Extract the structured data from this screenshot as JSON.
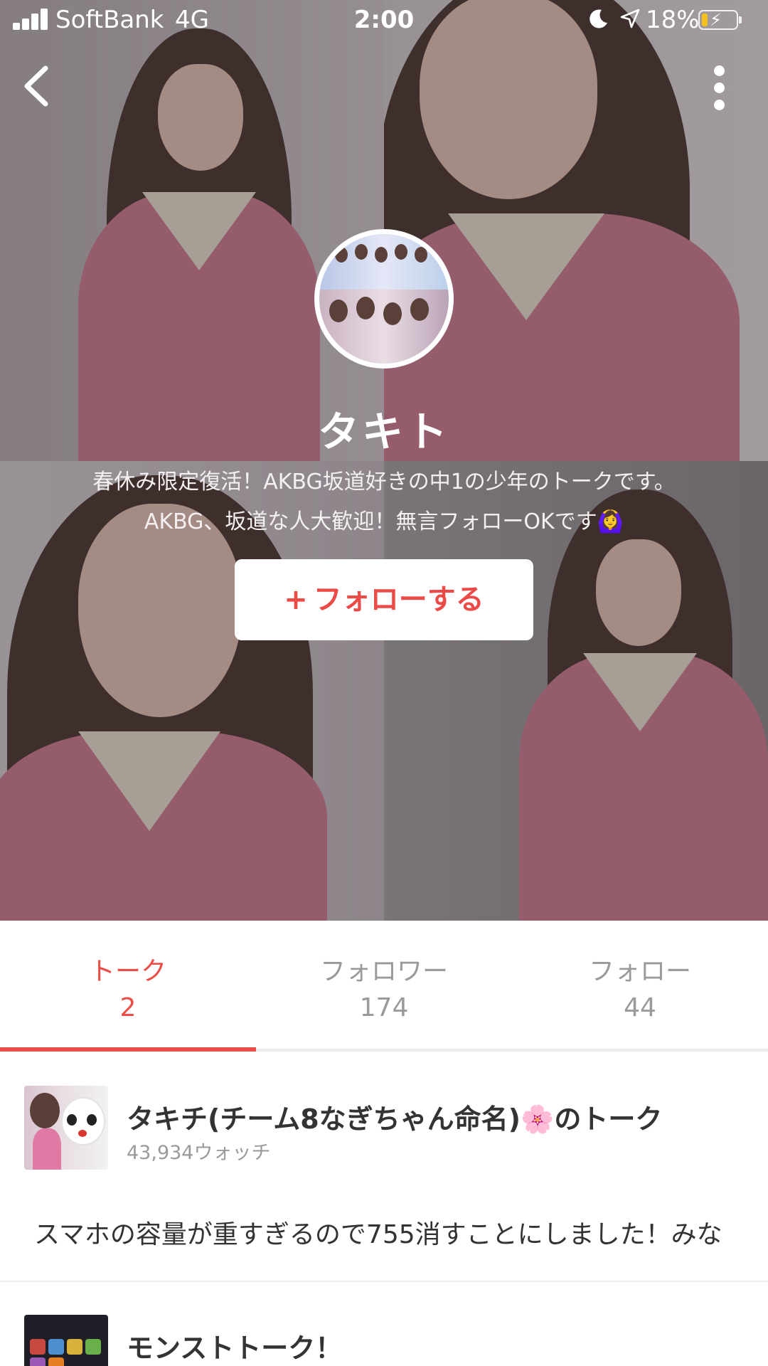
{
  "status_bar": {
    "carrier": "SoftBank",
    "network": "4G",
    "time": "2:00",
    "battery_percent": "18%",
    "battery_level": 0.18,
    "icons": [
      "signal-icon",
      "moon-icon",
      "location-arrow-icon",
      "battery-charging-icon"
    ]
  },
  "nav": {
    "back_icon": "chevron-left-icon",
    "more_icon": "vertical-ellipsis-icon"
  },
  "profile": {
    "name": "タキト",
    "bio": "春休み限定復活！AKBG坂道好きの中1の少年のトークです。AKBG、坂道な人大歓迎！無言フォローOKです🙆‍♀️",
    "follow_label": "フォローする",
    "follow_icon": "plus-icon"
  },
  "stats": {
    "tabs": [
      {
        "label": "トーク",
        "count": "2"
      },
      {
        "label": "フォロワー",
        "count": "174"
      },
      {
        "label": "フォロー",
        "count": "44"
      }
    ],
    "active_index": 0
  },
  "talks": [
    {
      "title": "タキチ(チーム8なぎちゃん命名)🌸のトーク",
      "watch": "43,934ウォッチ",
      "preview": "スマホの容量が重すぎるので755消すことにしました！みな"
    },
    {
      "title": "モンストトーク！",
      "watch": "",
      "preview": ""
    }
  ],
  "colors": {
    "accent": "#ea4e46",
    "muted_text": "#9a9a9a",
    "body_text": "#333333",
    "battery": "#f4c21b"
  }
}
